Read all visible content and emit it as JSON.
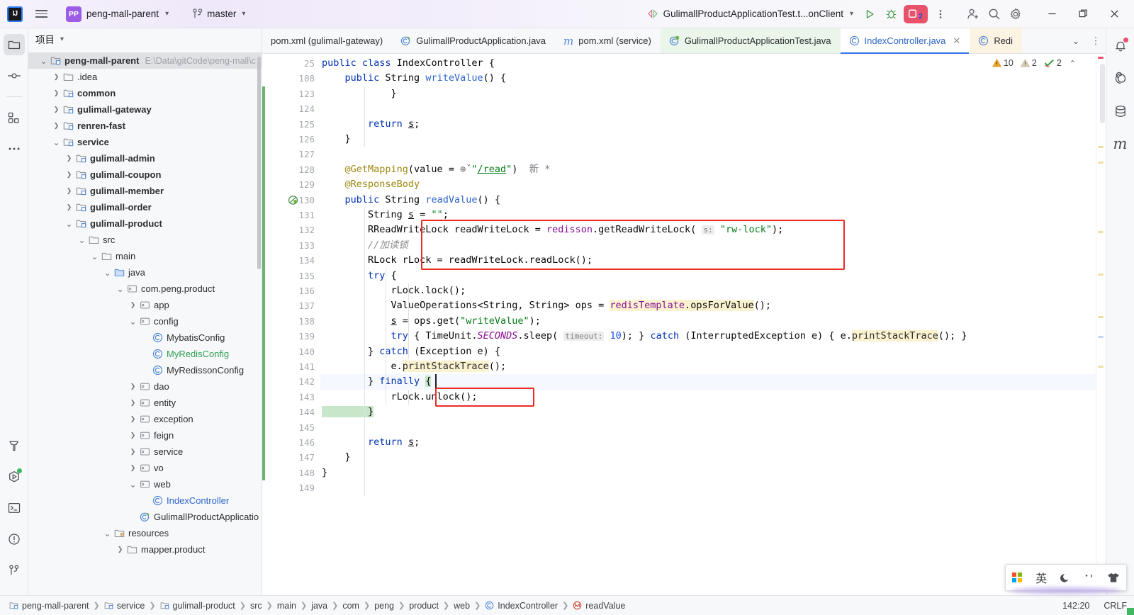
{
  "titlebar": {
    "logo_text": "IJ",
    "project_badge": "PP",
    "project_name": "peng-mall-parent",
    "branch_name": "master",
    "run_config": "GulimallProductApplicationTest.t...onClient",
    "debug_badge_count": "2",
    "icons": {
      "menu": "hamburger-menu-icon",
      "vcs": "git-branch-icon",
      "run": "run-icon",
      "debug": "debug-icon",
      "more": "more-vertical-icon",
      "share": "add-user-icon",
      "search": "search-icon",
      "settings": "gear-icon",
      "minimize": "minimize-icon",
      "maximize": "maximize-icon",
      "close": "close-icon"
    }
  },
  "left_rail": {
    "top": [
      {
        "name": "project-tool-icon",
        "active": true
      },
      {
        "name": "commit-tool-icon",
        "active": false
      },
      {
        "name": "structure-tool-icon",
        "active": false
      },
      {
        "name": "more-tools-icon",
        "active": false
      }
    ],
    "bottom": [
      {
        "name": "build-tool-icon",
        "dot": false
      },
      {
        "name": "services-tool-icon",
        "dot": true
      },
      {
        "name": "terminal-tool-icon",
        "dot": false
      },
      {
        "name": "problems-tool-icon",
        "dot": false
      },
      {
        "name": "git-tool-icon",
        "dot": false
      }
    ]
  },
  "project_panel": {
    "title": "项目",
    "root_path_hint": "E:\\Data\\gitCode\\peng-mall\\c",
    "tree": [
      {
        "label": "peng-mall-parent",
        "depth": 0,
        "arrow": "down",
        "icon": "module-icon",
        "bold": true,
        "selected": true,
        "hint": "E:\\Data\\gitCode\\peng-mall\\c"
      },
      {
        "label": ".idea",
        "depth": 1,
        "arrow": "right",
        "icon": "folder-icon",
        "bold": false,
        "selected": false
      },
      {
        "label": "common",
        "depth": 1,
        "arrow": "right",
        "icon": "module-icon",
        "bold": true,
        "selected": false
      },
      {
        "label": "gulimall-gateway",
        "depth": 1,
        "arrow": "right",
        "icon": "module-icon",
        "bold": true,
        "selected": false
      },
      {
        "label": "renren-fast",
        "depth": 1,
        "arrow": "right",
        "icon": "module-icon",
        "bold": true,
        "selected": false
      },
      {
        "label": "service",
        "depth": 1,
        "arrow": "down",
        "icon": "module-icon",
        "bold": true,
        "selected": false
      },
      {
        "label": "gulimall-admin",
        "depth": 2,
        "arrow": "right",
        "icon": "module-icon",
        "bold": true,
        "selected": false
      },
      {
        "label": "gulimall-coupon",
        "depth": 2,
        "arrow": "right",
        "icon": "module-icon",
        "bold": true,
        "selected": false
      },
      {
        "label": "gulimall-member",
        "depth": 2,
        "arrow": "right",
        "icon": "module-icon",
        "bold": true,
        "selected": false
      },
      {
        "label": "gulimall-order",
        "depth": 2,
        "arrow": "right",
        "icon": "module-icon",
        "bold": true,
        "selected": false
      },
      {
        "label": "gulimall-product",
        "depth": 2,
        "arrow": "down",
        "icon": "module-icon",
        "bold": true,
        "selected": false
      },
      {
        "label": "src",
        "depth": 3,
        "arrow": "down",
        "icon": "folder-icon",
        "bold": false,
        "selected": false
      },
      {
        "label": "main",
        "depth": 4,
        "arrow": "down",
        "icon": "folder-icon",
        "bold": false,
        "selected": false
      },
      {
        "label": "java",
        "depth": 5,
        "arrow": "down",
        "icon": "source-folder-icon",
        "bold": false,
        "selected": false
      },
      {
        "label": "com.peng.product",
        "depth": 6,
        "arrow": "down",
        "icon": "package-icon",
        "bold": false,
        "selected": false
      },
      {
        "label": "app",
        "depth": 7,
        "arrow": "right",
        "icon": "package-icon",
        "bold": false,
        "selected": false
      },
      {
        "label": "config",
        "depth": 7,
        "arrow": "down",
        "icon": "package-icon",
        "bold": false,
        "selected": false
      },
      {
        "label": "MybatisConfig",
        "depth": 8,
        "arrow": "none",
        "icon": "java-class-icon",
        "bold": false,
        "selected": false
      },
      {
        "label": "MyRedisConfig",
        "depth": 8,
        "arrow": "none",
        "icon": "java-class-icon",
        "bold": false,
        "selected": false,
        "color": "green"
      },
      {
        "label": "MyRedissonConfig",
        "depth": 8,
        "arrow": "none",
        "icon": "java-class-icon",
        "bold": false,
        "selected": false
      },
      {
        "label": "dao",
        "depth": 7,
        "arrow": "right",
        "icon": "package-icon",
        "bold": false,
        "selected": false
      },
      {
        "label": "entity",
        "depth": 7,
        "arrow": "right",
        "icon": "package-icon",
        "bold": false,
        "selected": false
      },
      {
        "label": "exception",
        "depth": 7,
        "arrow": "right",
        "icon": "package-icon",
        "bold": false,
        "selected": false
      },
      {
        "label": "feign",
        "depth": 7,
        "arrow": "right",
        "icon": "package-icon",
        "bold": false,
        "selected": false
      },
      {
        "label": "service",
        "depth": 7,
        "arrow": "right",
        "icon": "package-icon",
        "bold": false,
        "selected": false
      },
      {
        "label": "vo",
        "depth": 7,
        "arrow": "right",
        "icon": "package-icon",
        "bold": false,
        "selected": false
      },
      {
        "label": "web",
        "depth": 7,
        "arrow": "down",
        "icon": "package-icon",
        "bold": false,
        "selected": false
      },
      {
        "label": "IndexController",
        "depth": 8,
        "arrow": "none",
        "icon": "java-class-icon",
        "bold": false,
        "selected": false,
        "color": "blue"
      },
      {
        "label": "GulimallProductApplicatio",
        "depth": 7,
        "arrow": "none",
        "icon": "spring-class-icon",
        "bold": false,
        "selected": false
      },
      {
        "label": "resources",
        "depth": 5,
        "arrow": "down",
        "icon": "resource-folder-icon",
        "bold": false,
        "selected": false
      },
      {
        "label": "mapper.product",
        "depth": 6,
        "arrow": "right",
        "icon": "folder-icon",
        "bold": false,
        "selected": false
      }
    ]
  },
  "editor_tabs": [
    {
      "label": "pom.xml (gulimall-gateway)",
      "icon": "none",
      "bg": "plain",
      "active": false,
      "closable": false
    },
    {
      "label": "GulimallProductApplication.java",
      "icon": "spring-class-icon",
      "bg": "plain",
      "active": false,
      "closable": false
    },
    {
      "label": "pom.xml (service)",
      "icon": "maven-icon",
      "bg": "plain",
      "active": false,
      "closable": false
    },
    {
      "label": "GulimallProductApplicationTest.java",
      "icon": "test-class-icon",
      "bg": "green",
      "active": false,
      "closable": false
    },
    {
      "label": "IndexController.java",
      "icon": "java-class-icon",
      "bg": "active",
      "active": true,
      "closable": true
    },
    {
      "label": "Redi",
      "icon": "java-class-icon",
      "bg": "orange",
      "active": false,
      "closable": false
    }
  ],
  "inspection": {
    "warnings": "10",
    "weak_warnings": "2",
    "typos": "2"
  },
  "editor": {
    "lines": [
      {
        "num": "25",
        "indent": 0
      },
      {
        "num": "108",
        "indent": 0
      },
      {
        "num": "123",
        "indent": 0
      },
      {
        "num": "124",
        "indent": 0
      },
      {
        "num": "125",
        "indent": 0
      },
      {
        "num": "126",
        "indent": 0
      },
      {
        "num": "127",
        "indent": 0
      },
      {
        "num": "128",
        "indent": 0
      },
      {
        "num": "129",
        "indent": 0
      },
      {
        "num": "130",
        "indent": 0
      },
      {
        "num": "131",
        "indent": 0
      },
      {
        "num": "132",
        "indent": 0
      },
      {
        "num": "133",
        "indent": 0
      },
      {
        "num": "134",
        "indent": 0
      },
      {
        "num": "135",
        "indent": 0
      },
      {
        "num": "136",
        "indent": 0
      },
      {
        "num": "137",
        "indent": 0
      },
      {
        "num": "138",
        "indent": 0
      },
      {
        "num": "139",
        "indent": 0
      },
      {
        "num": "140",
        "indent": 0
      },
      {
        "num": "141",
        "indent": 0
      },
      {
        "num": "142",
        "indent": 0
      },
      {
        "num": "143",
        "indent": 0
      },
      {
        "num": "144",
        "indent": 0
      },
      {
        "num": "145",
        "indent": 0
      },
      {
        "num": "146",
        "indent": 0
      },
      {
        "num": "147",
        "indent": 0
      },
      {
        "num": "148",
        "indent": 0
      },
      {
        "num": "149",
        "indent": 0
      }
    ],
    "source_text": [
      "public class IndexController {",
      "    public String writeValue() {",
      "            }",
      "",
      "        return s;",
      "    }",
      "",
      "    @GetMapping(value = \"/read\")  新 *",
      "    @ResponseBody",
      "    public String readValue() {",
      "        String s = \"\";",
      "        RReadWriteLock readWriteLock = redisson.getReadWriteLock( s: \"rw-lock\");",
      "        //加读锁",
      "        RLock rLock = readWriteLock.readLock();",
      "        try {",
      "            rLock.lock();",
      "            ValueOperations<String, String> ops = redisTemplate.opsForValue();",
      "            s = ops.get(\"writeValue\");",
      "            try { TimeUnit.SECONDS.sleep( timeout: 10); } catch (InterruptedException e) { e.printStackTrace(); }",
      "        } catch (Exception e) {",
      "            e.printStackTrace();",
      "        } finally {",
      "            rLock.unlock();",
      "        }",
      "",
      "        return s;",
      "    }",
      "}",
      ""
    ],
    "current_line": "142",
    "gutter_run_marker_line": "130"
  },
  "status_bar": {
    "breadcrumbs": [
      {
        "label": "peng-mall-parent",
        "icon": "module-icon"
      },
      {
        "label": "service",
        "icon": "module-icon"
      },
      {
        "label": "gulimall-product",
        "icon": "module-icon"
      },
      {
        "label": "src",
        "icon": "none"
      },
      {
        "label": "main",
        "icon": "none"
      },
      {
        "label": "java",
        "icon": "none"
      },
      {
        "label": "com",
        "icon": "none"
      },
      {
        "label": "peng",
        "icon": "none"
      },
      {
        "label": "product",
        "icon": "none"
      },
      {
        "label": "web",
        "icon": "none"
      },
      {
        "label": "IndexController",
        "icon": "java-class-icon"
      },
      {
        "label": "readValue",
        "icon": "method-icon"
      }
    ],
    "caret_position": "142:20",
    "line_separator": "CRLF"
  },
  "right_rail": [
    {
      "name": "notifications-icon",
      "dot": true
    },
    {
      "name": "nacos-icon",
      "dot": false
    },
    {
      "name": "database-icon",
      "dot": false
    },
    {
      "name": "maven-icon",
      "dot": false
    }
  ],
  "ime_bar": {
    "windows_logo": "windows-logo-icon",
    "mode_label": "英",
    "moon": "moon-icon",
    "comma": "punctuation-icon",
    "skin": "skin-icon"
  },
  "colors": {
    "accent_blue": "#3574f0",
    "purple_badge": "#9b5de5",
    "debug_red": "#e8526a",
    "redbox": "#ec2b25",
    "vcs_green": "#6cb36c",
    "string_green": "#067d17",
    "keyword_blue": "#0033b3",
    "annotation_gold": "#9e880d",
    "field_purple": "#871094"
  }
}
